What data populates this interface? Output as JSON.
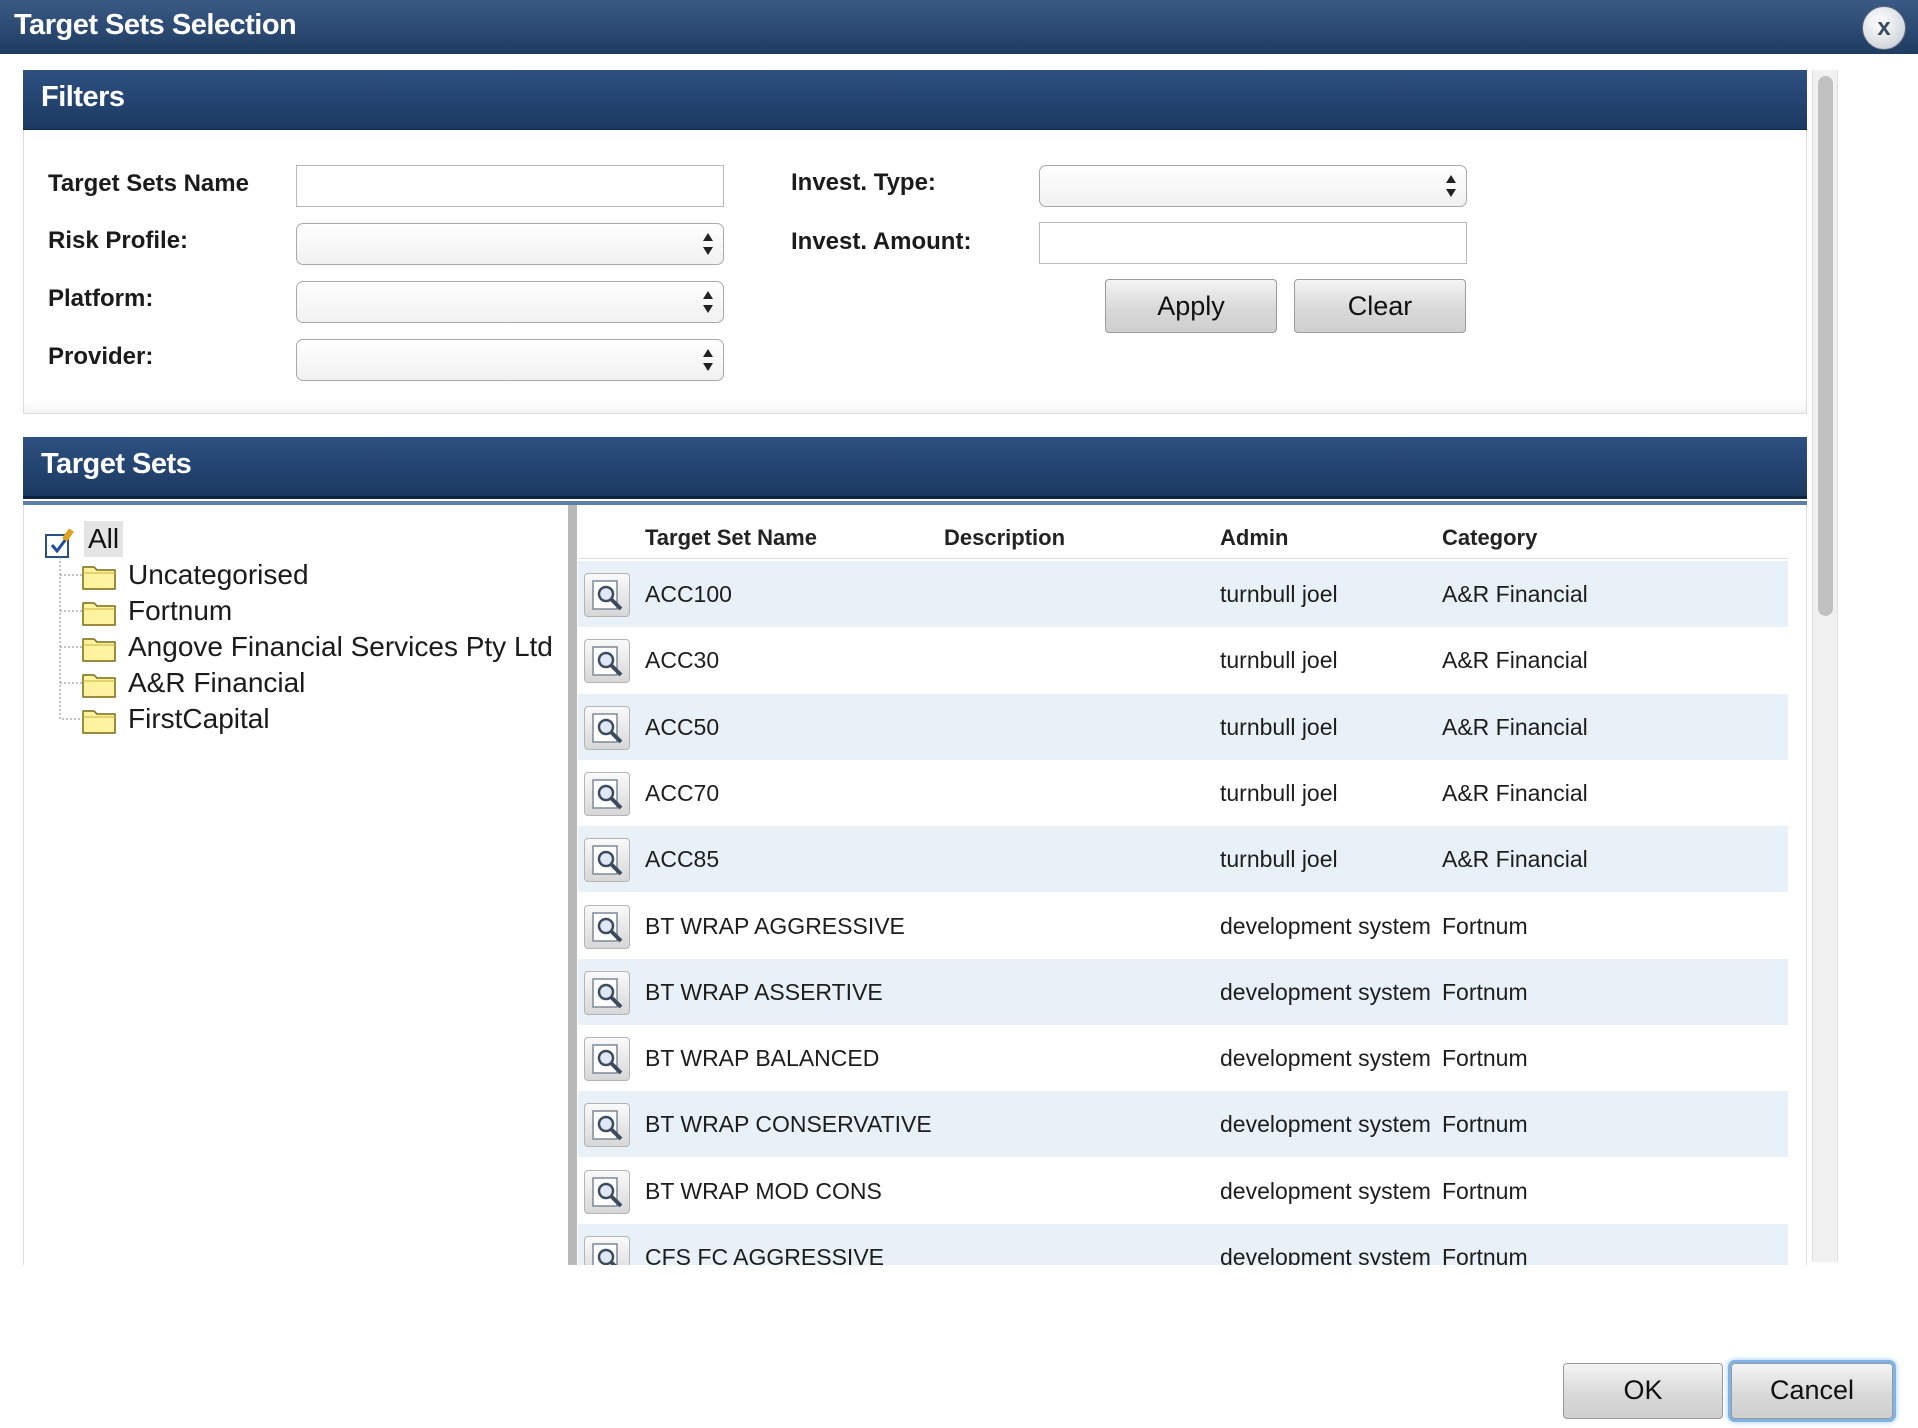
{
  "window": {
    "title": "Target Sets Selection",
    "close_label": "x"
  },
  "filters": {
    "title": "Filters",
    "target_sets_name_label": "Target Sets Name",
    "target_sets_name_value": "",
    "risk_profile_label": "Risk Profile:",
    "risk_profile_value": "",
    "platform_label": "Platform:",
    "platform_value": "",
    "provider_label": "Provider:",
    "provider_value": "",
    "invest_type_label": "Invest. Type:",
    "invest_type_value": "",
    "invest_amount_label": "Invest. Amount:",
    "invest_amount_value": "",
    "apply_label": "Apply",
    "clear_label": "Clear"
  },
  "target_sets": {
    "title": "Target Sets",
    "tree": {
      "root_label": "All",
      "items": [
        "Uncategorised",
        "Fortnum",
        "Angove Financial Services Pty Ltd",
        "A&R Financial",
        "FirstCapital"
      ]
    },
    "columns": [
      "Target Set Name",
      "Description",
      "Admin",
      "Category"
    ],
    "rows": [
      {
        "name": "ACC100",
        "description": "",
        "admin": "turnbull joel",
        "category": "A&R Financial"
      },
      {
        "name": "ACC30",
        "description": "",
        "admin": "turnbull joel",
        "category": "A&R Financial"
      },
      {
        "name": "ACC50",
        "description": "",
        "admin": "turnbull joel",
        "category": "A&R Financial"
      },
      {
        "name": "ACC70",
        "description": "",
        "admin": "turnbull joel",
        "category": "A&R Financial"
      },
      {
        "name": "ACC85",
        "description": "",
        "admin": "turnbull joel",
        "category": "A&R Financial"
      },
      {
        "name": "BT WRAP AGGRESSIVE",
        "description": "",
        "admin": "development system",
        "category": "Fortnum"
      },
      {
        "name": "BT WRAP ASSERTIVE",
        "description": "",
        "admin": "development system",
        "category": "Fortnum"
      },
      {
        "name": "BT WRAP BALANCED",
        "description": "",
        "admin": "development system",
        "category": "Fortnum"
      },
      {
        "name": "BT WRAP CONSERVATIVE",
        "description": "",
        "admin": "development system",
        "category": "Fortnum"
      },
      {
        "name": "BT WRAP MOD CONS",
        "description": "",
        "admin": "development system",
        "category": "Fortnum"
      },
      {
        "name": "CFS FC AGGRESSIVE",
        "description": "",
        "admin": "development system",
        "category": "Fortnum"
      }
    ]
  },
  "footer": {
    "ok_label": "OK",
    "cancel_label": "Cancel"
  },
  "colors": {
    "header_navy": "#234470",
    "row_alt": "#e8f1f7",
    "focus_ring": "#7fb2e6"
  }
}
